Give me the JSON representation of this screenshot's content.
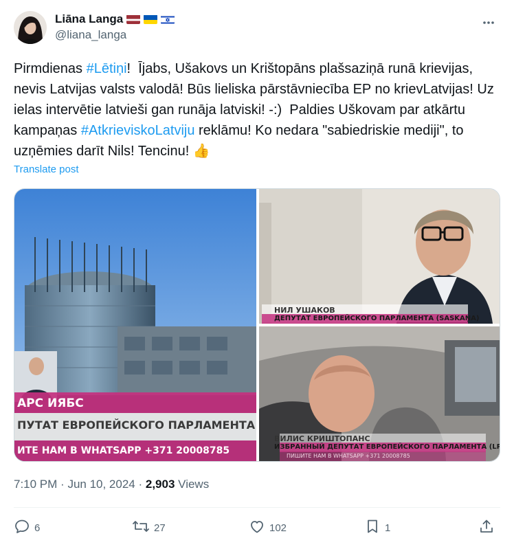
{
  "author": {
    "display_name": "Liāna Langa",
    "handle": "@liana_langa",
    "flags": [
      "latvia-flag-icon",
      "ukraine-flag-icon",
      "israel-flag-icon"
    ]
  },
  "post": {
    "text_parts": [
      {
        "t": "Pirmdienas ",
        "tag": false
      },
      {
        "t": "#Lētiņi",
        "tag": true
      },
      {
        "t": "!  Ījabs, Ušakovs un Krištopāns plašsaziņā runā krievijas, nevis Latvijas valsts valodā! Būs lieliska pārstāvniecība EP no kriev­Latvijas! Uz ielas intervētie latvieši gan runāja latviski! -:)  Paldies Uškovam par atkārtu kampaņas ",
        "tag": false
      },
      {
        "t": "#AtkrieviskoLatviju",
        "tag": true
      },
      {
        "t": " reklāmu! Ko nedara \"sabiedriskie mediji\", to uzņēmies darīt Nils! Tencinu! 👍",
        "tag": false
      }
    ],
    "translate_label": "Translate post"
  },
  "media": {
    "image1": {
      "caption_name": "АРС ИЯБС",
      "caption_title": "ПУТАТ ЕВРОПЕЙСКОГО ПАРЛАМЕНТА (Л",
      "ticker": "ИТЕ НАМ В WHATSAPP +371 20008785"
    },
    "image2": {
      "caption_name": "НИЛ УШАКОВ",
      "caption_title": "ДЕПУТАТ ЕВРОПЕЙСКОГО ПАРЛАМЕНТА (SASKAŅA)"
    },
    "image3": {
      "caption_name": "ВИЛИС КРИШТОПАНС",
      "caption_title": "ИЗБРАННЫЙ ДЕПУТАТ ЕВРОПЕЙСКОГО ПАРЛАМЕНТА (LPV)",
      "ticker": "ПИШИТЕ НАМ В WHATSAPP +371 20008785"
    }
  },
  "meta": {
    "time": "7:10 PM",
    "date": "Jun 10, 2024",
    "views_count": "2,903",
    "views_label": "Views"
  },
  "actions": {
    "replies": "6",
    "reposts": "27",
    "likes": "102",
    "bookmarks": "1"
  },
  "colors": {
    "accent": "#1d9bf0",
    "text": "#0f1419",
    "secondary": "#536471",
    "caption_magenta": "#c4307f"
  }
}
